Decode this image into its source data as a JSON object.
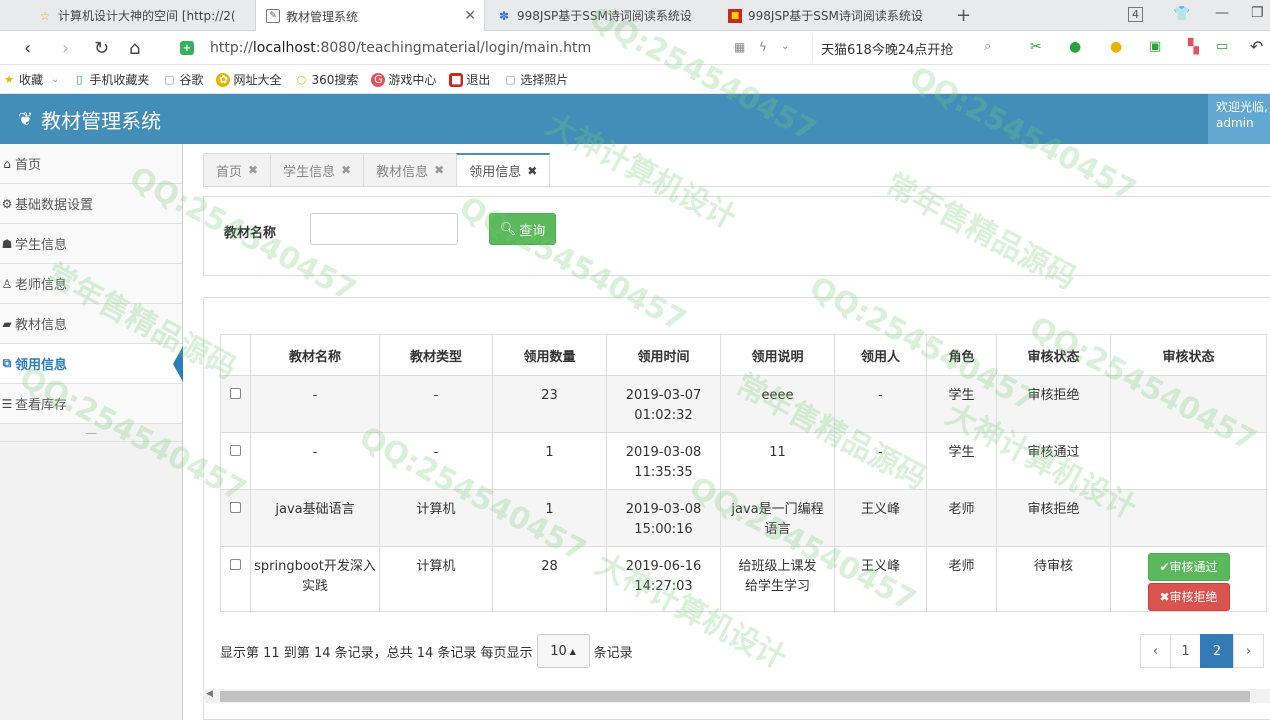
{
  "browser": {
    "tabs": [
      {
        "title": "计算机设计大神的空间 [http://2("
      },
      {
        "title": "教材管理系统"
      },
      {
        "title": "998JSP基于SSM诗词阅读系统设"
      },
      {
        "title": "998JSP基于SSM诗词阅读系统设"
      }
    ],
    "tab_count": "4",
    "url_prefix": "http://",
    "url_host": "localhost",
    "url_rest": ":8080/teachingmaterial/login/main.htm",
    "search_promo": "天猫618今晚24点开抢",
    "bookmarks": [
      "收藏",
      "手机收藏夹",
      "谷歌",
      "网址大全",
      "360搜索",
      "游戏中心",
      "退出",
      "选择照片"
    ]
  },
  "app": {
    "title": "教材管理系统",
    "welcome_line1": "欢迎光临,",
    "welcome_line2": "admin"
  },
  "sidebar": {
    "items": [
      {
        "label": "首页",
        "icon": "home-icon"
      },
      {
        "label": "基础数据设置",
        "icon": "cog-icon"
      },
      {
        "label": "学生信息",
        "icon": "users-icon"
      },
      {
        "label": "老师信息",
        "icon": "user-icon"
      },
      {
        "label": "教材信息",
        "icon": "book-icon"
      },
      {
        "label": "领用信息",
        "icon": "link-icon"
      },
      {
        "label": "查看库存",
        "icon": "list-icon"
      }
    ],
    "active_index": 5
  },
  "inner_tabs": [
    "首页",
    "学生信息",
    "教材信息",
    "领用信息"
  ],
  "search": {
    "label": "教材名称",
    "value": "",
    "button": "查询"
  },
  "table": {
    "headers": [
      "教材名称",
      "教材类型",
      "领用数量",
      "领用时间",
      "领用说明",
      "领用人",
      "角色",
      "审核状态",
      "审核状态"
    ],
    "rows": [
      {
        "name": "-",
        "type": "-",
        "qty": "23",
        "time1": "2019-03-07",
        "time2": "01:02:32",
        "desc1": "eeee",
        "desc2": "",
        "person": "-",
        "role": "学生",
        "status": "审核拒绝"
      },
      {
        "name": "-",
        "type": "-",
        "qty": "1",
        "time1": "2019-03-08",
        "time2": "11:35:35",
        "desc1": "11",
        "desc2": "",
        "person": "-",
        "role": "学生",
        "status": "审核通过"
      },
      {
        "name": "java基础语言",
        "type": "计算机",
        "qty": "1",
        "time1": "2019-03-08",
        "time2": "15:00:16",
        "desc1": "java是一门编程",
        "desc2": "语言",
        "person": "王义峰",
        "role": "老师",
        "status": "审核拒绝"
      },
      {
        "name": "springboot开发深入实践",
        "type": "计算机",
        "qty": "28",
        "time1": "2019-06-16",
        "time2": "14:27:03",
        "desc1": "给班级上课发",
        "desc2": "给学生学习",
        "person": "王义峰",
        "role": "老师",
        "status": "待审核"
      }
    ],
    "approve_label": "审核通过",
    "reject_label": "审核拒绝"
  },
  "pager": {
    "info_prefix": "显示第 11 到第 14 条记录，总共 14 条记录 每页显示",
    "page_size": "10",
    "info_suffix": "条记录",
    "prev": "‹",
    "pages": [
      "1",
      "2"
    ],
    "current": "2",
    "next": "›"
  },
  "watermarks": [
    "QQ:254540457",
    "大神计算机设计",
    "常年售精品源码"
  ]
}
